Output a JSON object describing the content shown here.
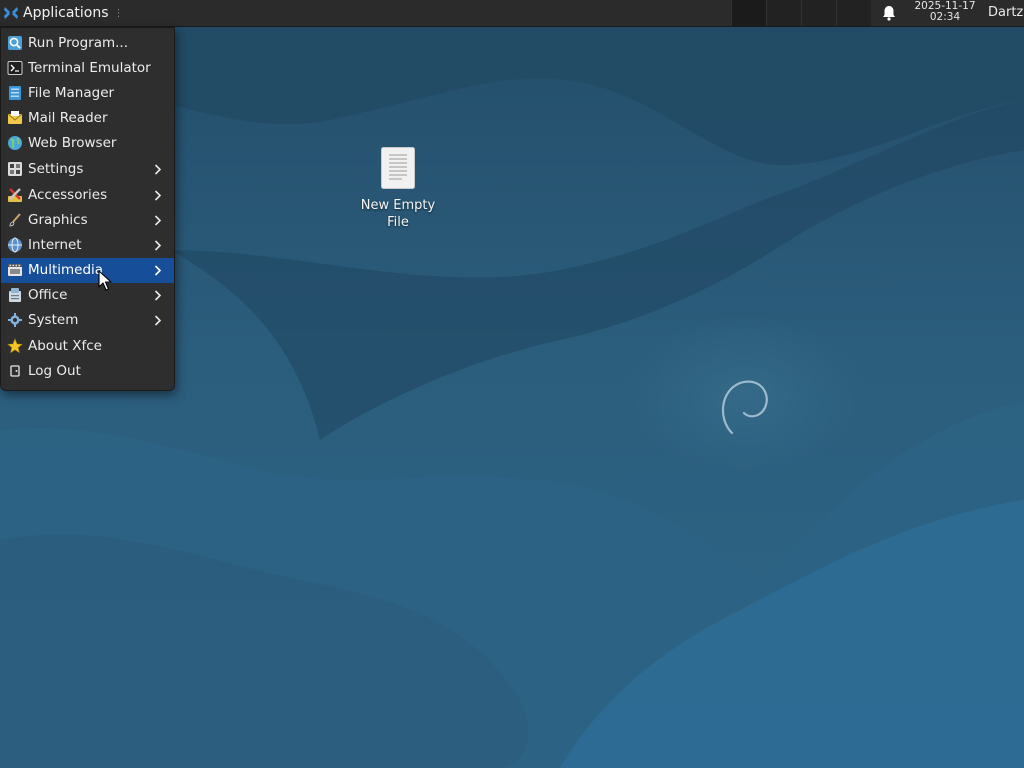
{
  "panel": {
    "applications_label": "Applications",
    "clock_date": "2025-11-17",
    "clock_time": "02:34",
    "user_label": "Dartz",
    "icons": {
      "applications": "xfce-logo-icon",
      "notifications": "bell-icon"
    }
  },
  "menu": {
    "items": [
      {
        "label": "Run Program...",
        "icon": "search-icon",
        "submenu": false
      },
      {
        "label": "Terminal Emulator",
        "icon": "terminal-icon",
        "submenu": false
      },
      {
        "label": "File Manager",
        "icon": "file-manager-icon",
        "submenu": false
      },
      {
        "label": "Mail Reader",
        "icon": "mail-icon",
        "submenu": false
      },
      {
        "label": "Web Browser",
        "icon": "globe-icon",
        "submenu": false
      },
      {
        "label": "Settings",
        "icon": "settings-icon",
        "submenu": true
      },
      {
        "label": "Accessories",
        "icon": "accessories-icon",
        "submenu": true
      },
      {
        "label": "Graphics",
        "icon": "brush-icon",
        "submenu": true
      },
      {
        "label": "Internet",
        "icon": "internet-icon",
        "submenu": true
      },
      {
        "label": "Multimedia",
        "icon": "film-icon",
        "submenu": true,
        "highlighted": true
      },
      {
        "label": "Office",
        "icon": "office-icon",
        "submenu": true
      },
      {
        "label": "System",
        "icon": "gear-icon",
        "submenu": true
      },
      {
        "label": "About Xfce",
        "icon": "star-icon",
        "submenu": false
      },
      {
        "label": "Log Out",
        "icon": "logout-icon",
        "submenu": false
      }
    ]
  },
  "desktop": {
    "icons": [
      {
        "label": "New Empty File",
        "icon": "text-file-icon"
      }
    ]
  },
  "colors": {
    "panel_bg": "#2b2b2b",
    "menu_bg": "#2e2e2e",
    "menu_highlight": "#174e9a",
    "desktop_bg": "#2a5876"
  }
}
